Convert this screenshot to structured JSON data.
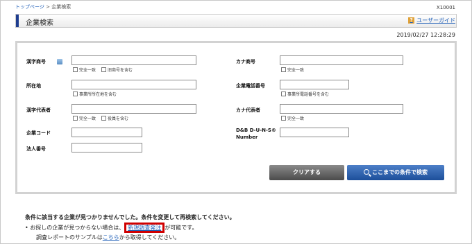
{
  "breadcrumb": {
    "home": "トップページ",
    "separator": ">",
    "current": "企業検索"
  },
  "screen_id": "X10001",
  "header": {
    "title": "企業検索",
    "guide_label": "ユーザーガイド",
    "guide_icon": "?"
  },
  "timestamp": "2019/02/27 12:28:29",
  "form": {
    "kanji_name": {
      "label": "漢字商号",
      "value": "",
      "cb1": "完全一致",
      "cb2": "旧商号を含む"
    },
    "kana_name": {
      "label": "カナ商号",
      "value": "",
      "cb1": "完全一致"
    },
    "address": {
      "label": "所在地",
      "value": "",
      "cb1": "事業所所在地を含む"
    },
    "phone": {
      "label": "企業電話番号",
      "value": "",
      "cb1": "事業所電話番号を含む"
    },
    "kanji_rep": {
      "label": "漢字代表者",
      "value": "",
      "cb1": "完全一致",
      "cb2": "役員を含む"
    },
    "kana_rep": {
      "label": "カナ代表者",
      "value": "",
      "cb1": "完全一致"
    },
    "company_code": {
      "label": "企業コード",
      "value": ""
    },
    "duns": {
      "label_line1": "D&B D-U-N-S®",
      "label_line2": "Number",
      "value": ""
    },
    "corp_number": {
      "label": "法人番号",
      "value": ""
    }
  },
  "buttons": {
    "clear": "クリアする",
    "search": "ここまでの条件で検索"
  },
  "footer": {
    "message": "条件に該当する企業が見つかりませんでした。条件を変更して再検索してください。",
    "bullet": "•",
    "line1_pre": "お探しの企業が見つからない場合は、",
    "line1_link": "新規調査発注",
    "line1_post": "が可能です。",
    "line2_pre": "調査レポートのサンプルは",
    "line2_link": "こちら",
    "line2_post": "から取得してください。"
  },
  "colors": {
    "accent": "#1e3d8f",
    "link": "#1f5fb8",
    "highlight": "#d00000",
    "search_button": "#1c4f9a"
  }
}
